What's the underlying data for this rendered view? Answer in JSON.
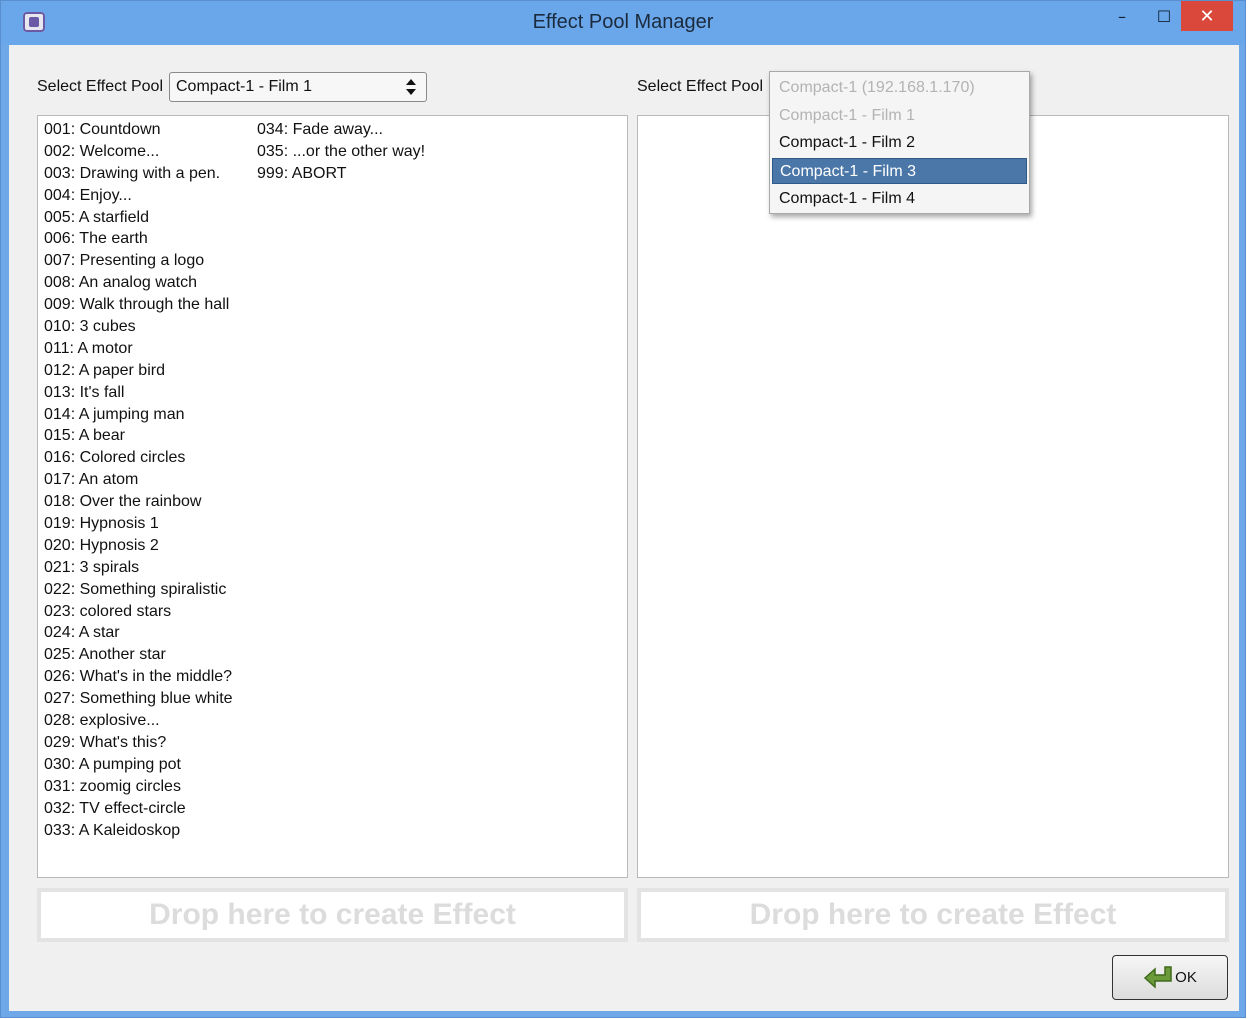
{
  "window": {
    "title": "Effect Pool Manager",
    "min": "–",
    "max": "☐",
    "close": "✕"
  },
  "left": {
    "select_label": "Select Effect Pool",
    "selected_pool": "Compact-1 - Film 1",
    "effects_col1": [
      "001: Countdown",
      "002: Welcome...",
      "003: Drawing with a pen.",
      "004: Enjoy...",
      "005: A starfield",
      "006: The earth",
      "007: Presenting a logo",
      "008: An analog watch",
      "009: Walk through the hall",
      "010: 3 cubes",
      "011: A motor",
      "012: A paper bird",
      "013: It's fall",
      "014: A jumping man",
      "015: A bear",
      "016: Colored circles",
      "017: An atom",
      "018: Over the rainbow",
      "019: Hypnosis 1",
      "020: Hypnosis 2",
      "021: 3 spirals",
      "022: Something spiralistic",
      "023: colored stars",
      "024: A star",
      "025: Another star",
      "026: What's in the middle?",
      "027: Something blue white",
      "028: explosive...",
      "029: What's this?",
      "030: A pumping pot",
      "031: zoomig circles",
      "032: TV effect-circle",
      "033: A Kaleidoskop"
    ],
    "effects_col2": [
      "034: Fade away...",
      "035: ...or the other way!",
      "999: ABORT"
    ],
    "drop_text": "Drop here to create Effect"
  },
  "right": {
    "select_label": "Select Effect Pool",
    "dropdown_options": [
      {
        "label": "Compact-1 (192.168.1.170)",
        "state": "disabled"
      },
      {
        "label": "Compact-1 - Film 1",
        "state": "disabled"
      },
      {
        "label": "Compact-1 - Film 2",
        "state": "normal"
      },
      {
        "label": "Compact-1 - Film 3",
        "state": "selected"
      },
      {
        "label": "Compact-1 - Film 4",
        "state": "normal"
      }
    ],
    "drop_text": "Drop here to create Effect"
  },
  "ok_label": "OK",
  "colors": {
    "titlebar": "#6aa6ea",
    "close": "#d9483b",
    "highlight": "#4a77a8"
  }
}
